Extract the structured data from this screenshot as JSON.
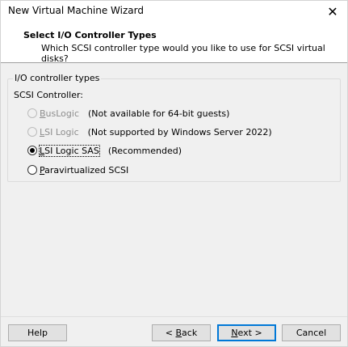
{
  "window": {
    "title": "New Virtual Machine Wizard",
    "close_glyph": "✕"
  },
  "header": {
    "title": "Select I/O Controller Types",
    "subtitle": "Which SCSI controller type would you like to use for SCSI virtual disks?"
  },
  "group": {
    "legend": "I/O controller types",
    "scsi_label": "SCSI Controller:"
  },
  "options": [
    {
      "accel": "B",
      "rest": "usLogic",
      "note": "(Not available for 64-bit guests)",
      "enabled": false,
      "selected": false
    },
    {
      "accel": "L",
      "rest": "SI Logic",
      "note": "(Not supported by Windows Server 2022)",
      "enabled": false,
      "selected": false
    },
    {
      "accel": "L",
      "rest": "SI Logic SAS",
      "note": "(Recommended)",
      "enabled": true,
      "selected": true
    },
    {
      "accel": "P",
      "rest": "aravirtualized SCSI",
      "note": "",
      "enabled": true,
      "selected": false
    }
  ],
  "buttons": {
    "help": "Help",
    "back_prefix": "< ",
    "back_accel": "B",
    "back_rest": "ack",
    "next_accel": "N",
    "next_rest": "ext >",
    "cancel": "Cancel"
  }
}
